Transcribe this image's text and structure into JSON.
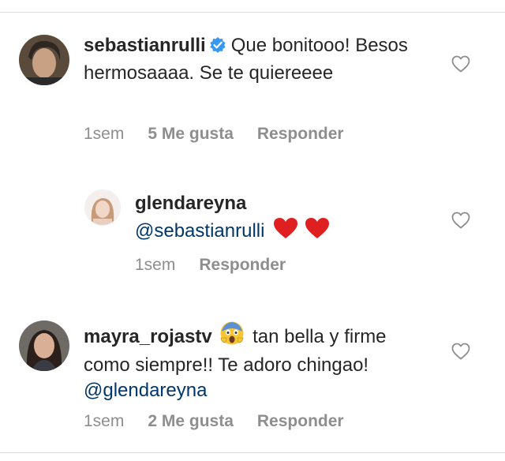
{
  "comments": [
    {
      "username": "sebastianrulli",
      "verified": true,
      "text": "Que bonitooo! Besos hermosaaaa. Se te quiereeee",
      "time": "1sem",
      "likes": "5 Me gusta",
      "reply": "Responder"
    },
    {
      "username": "glendareyna",
      "mention": "@sebastianrulli",
      "emoji": "❤️❤️",
      "time": "1sem",
      "reply": "Responder"
    },
    {
      "username": "mayra_rojastv",
      "emoji": "😱",
      "text": "tan bella y firme como siempre!! Te adoro chingao!",
      "mention": "@glendareyna",
      "time": "1sem",
      "likes": "2 Me gusta",
      "reply": "Responder"
    }
  ],
  "colors": {
    "text": "#262626",
    "muted": "#8e8e8e",
    "mention": "#00376b",
    "verified": "#3897f0",
    "divider": "#dbdbdb"
  },
  "icons": [
    "verified-badge-icon",
    "heart-outline-icon",
    "red-heart-emoji",
    "screaming-face-emoji"
  ]
}
